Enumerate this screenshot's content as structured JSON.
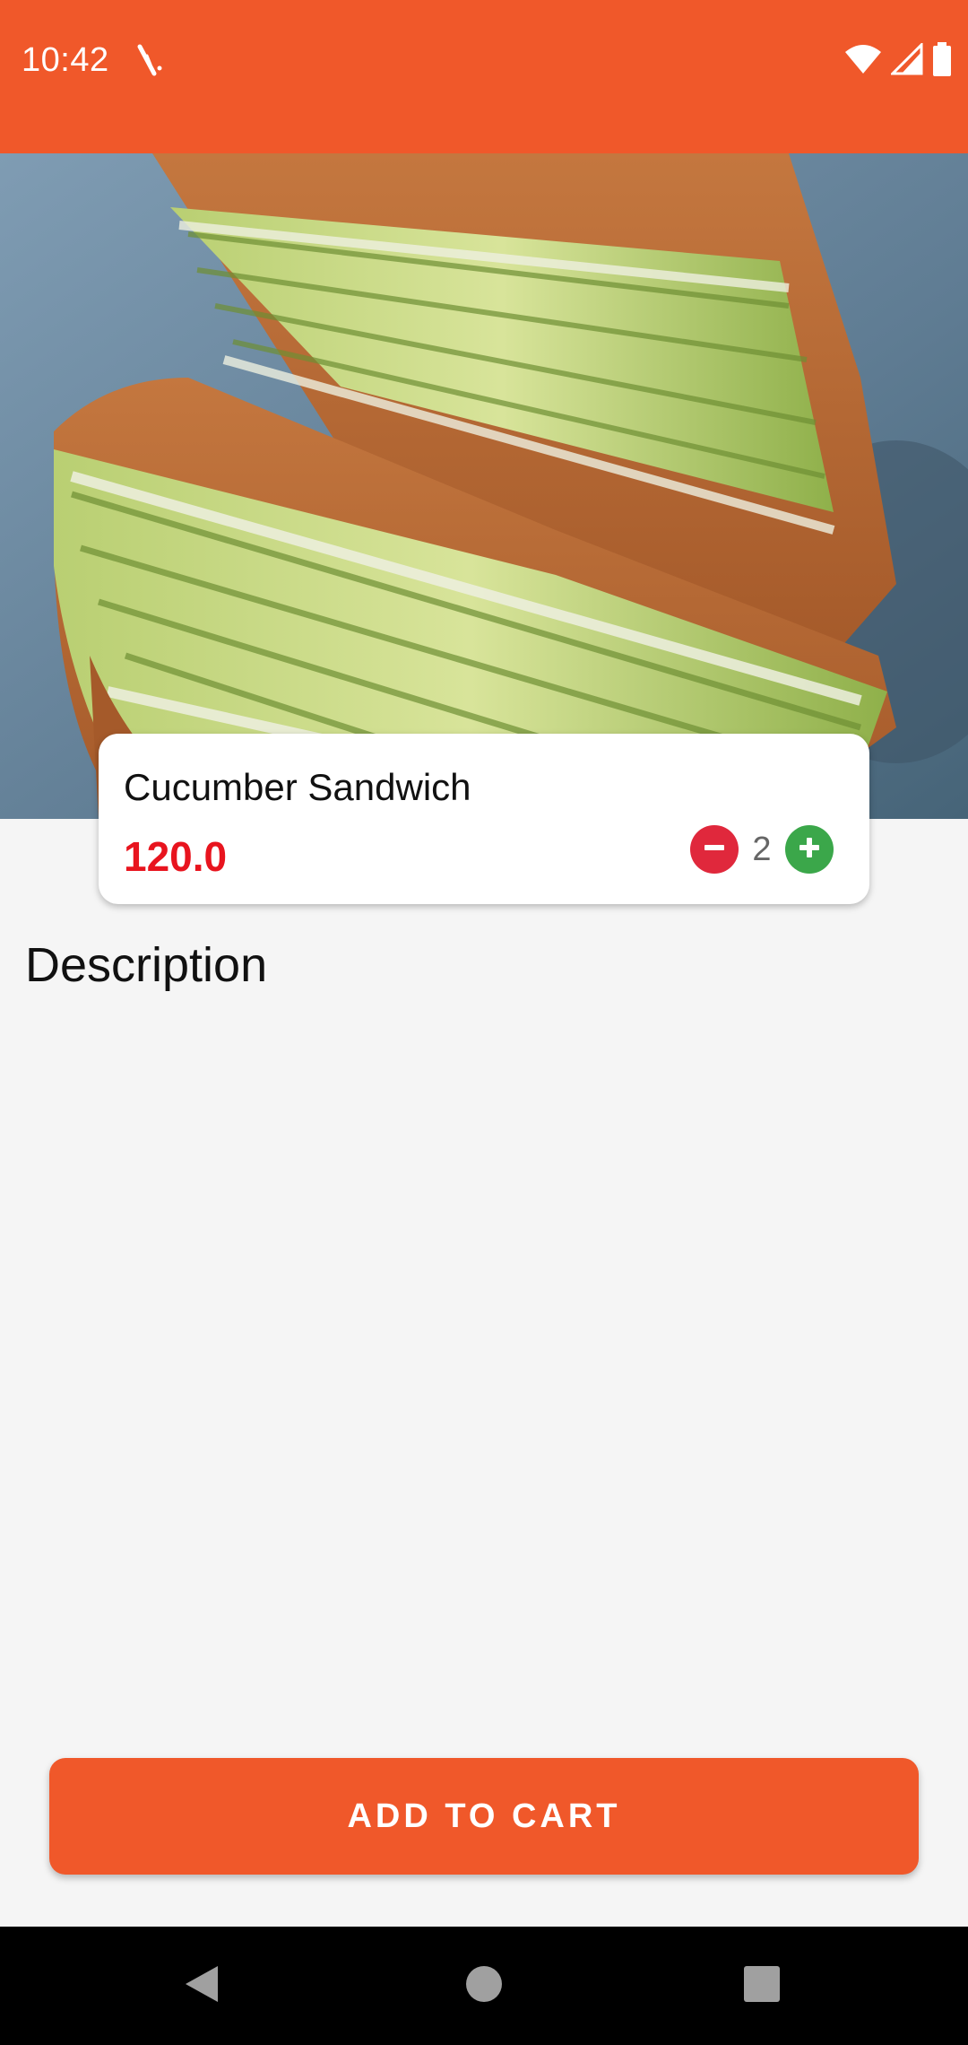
{
  "status_bar": {
    "time": "10:42",
    "bg_color": "#f0582a"
  },
  "hero": {
    "alt": "Cucumber Sandwich"
  },
  "product": {
    "name": "Cucumber Sandwich",
    "price": "120.0",
    "quantity": "2",
    "price_color": "#e8141e"
  },
  "description": {
    "heading": "Description"
  },
  "actions": {
    "add_to_cart_label": "ADD TO CART",
    "accent_color": "#f0582a"
  },
  "icons": {
    "decrease": "minus-circle-icon",
    "increase": "plus-circle-icon",
    "wifi": "wifi-icon",
    "signal": "cellular-signal-icon",
    "battery": "battery-icon",
    "back": "back-icon",
    "home": "home-icon",
    "recents": "recents-icon"
  }
}
